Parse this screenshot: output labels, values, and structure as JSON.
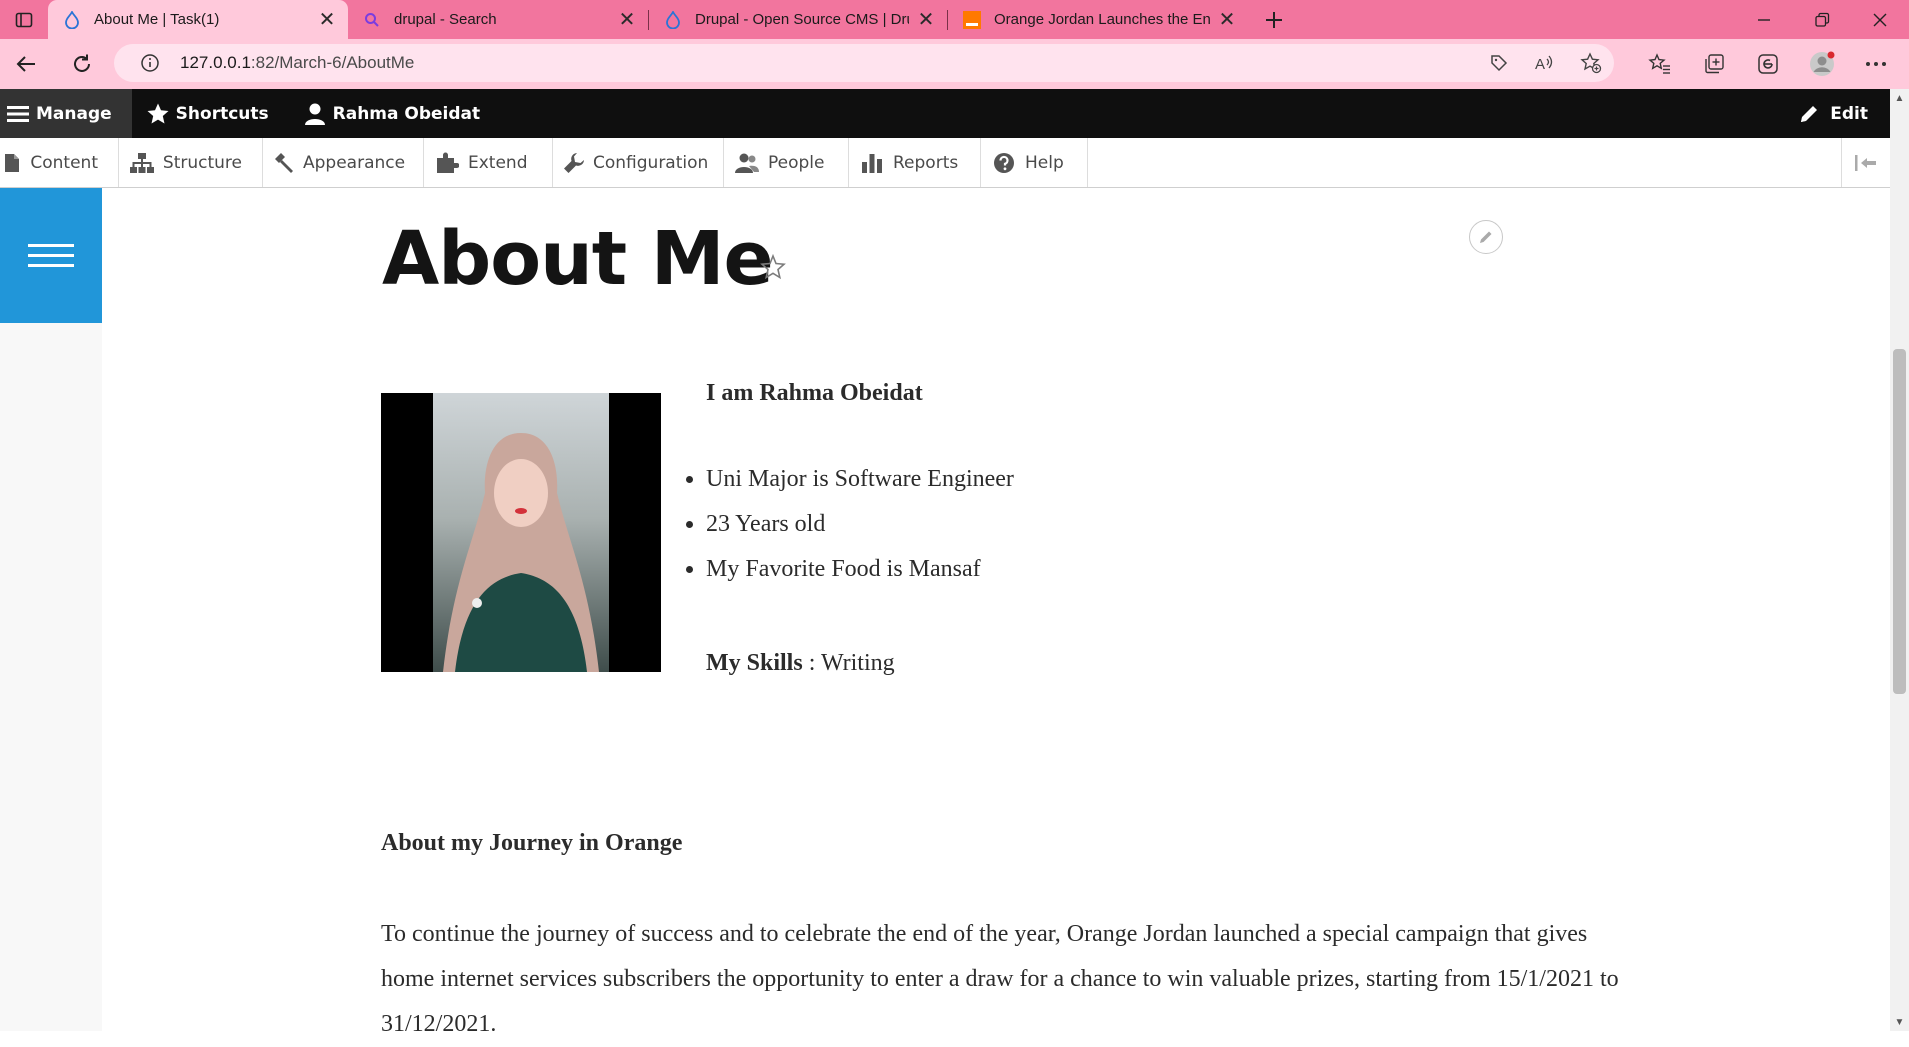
{
  "browser": {
    "tabs": [
      {
        "title": "About Me | Task(1)",
        "active": true,
        "icon": "drupal-drop-icon"
      },
      {
        "title": "drupal - Search",
        "active": false,
        "icon": "search-icon"
      },
      {
        "title": "Drupal - Open Source CMS | Dru",
        "active": false,
        "icon": "drupal-drop-icon"
      },
      {
        "title": "Orange Jordan Launches the End",
        "active": false,
        "icon": "orange-logo-icon"
      }
    ],
    "url_host": "127.0.0.1",
    "url_path": ":82/March-6/AboutMe",
    "colors": {
      "tab_strip": "#f2759e",
      "active_tab": "#ffc9db"
    }
  },
  "toolbar": {
    "manage": "Manage",
    "shortcuts": "Shortcuts",
    "user": "Rahma Obeidat",
    "edit": "Edit"
  },
  "tray": {
    "items": [
      "Content",
      "Structure",
      "Appearance",
      "Extend",
      "Configuration",
      "People",
      "Reports",
      "Help"
    ]
  },
  "page": {
    "title": "About Me",
    "intro": "I am Rahma Obeidat",
    "facts": [
      "Uni Major is Software Engineer",
      "23  Years old",
      "My Favorite Food is Mansaf"
    ],
    "skills_label": "My Skills",
    "skills_sep": " : ",
    "skills_value": "Writing",
    "journey_title": "About my Journey in Orange",
    "journey_text": "To continue the journey of success and to celebrate the end of the year, Orange Jordan launched a special campaign that gives home internet services subscribers the opportunity to enter a draw for a chance to win valuable prizes, starting from 15/1/2021 to 31/12/2021.",
    "accent_color": "#2196d9"
  }
}
